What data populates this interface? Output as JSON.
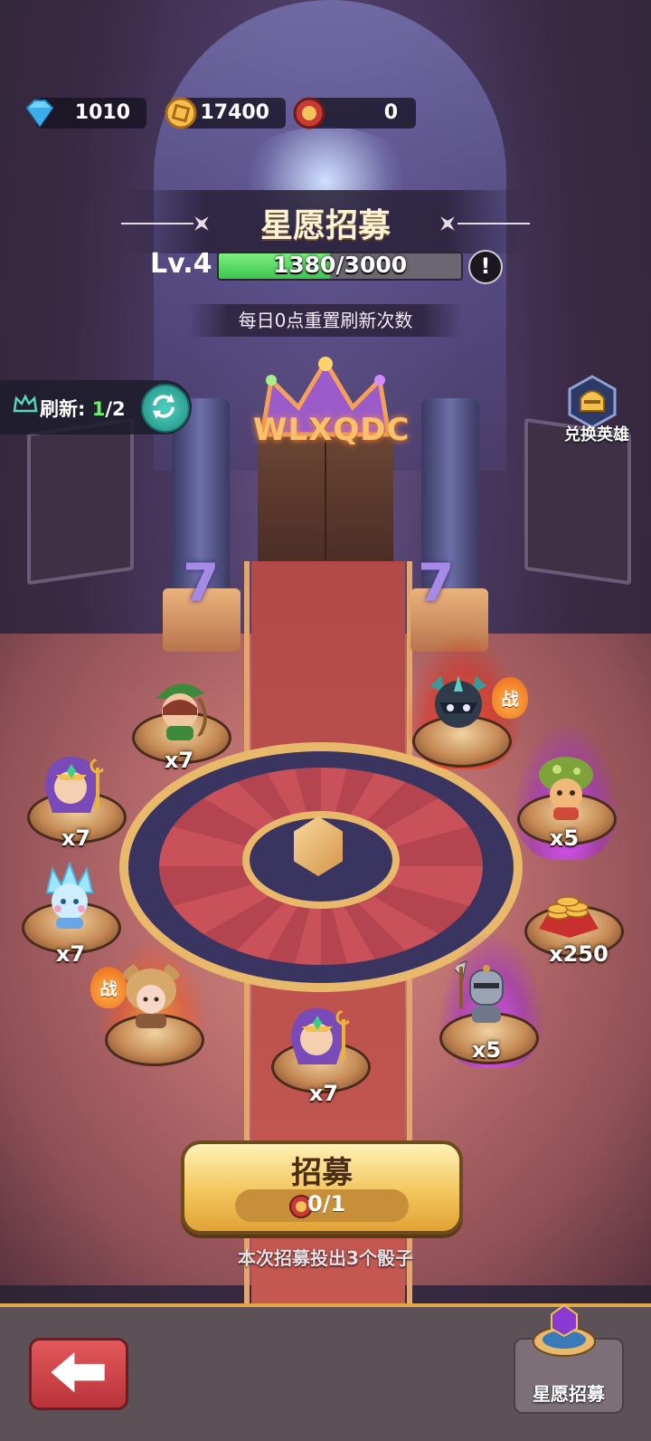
{
  "currencies": {
    "diamonds": "1010",
    "gold": "17400",
    "tokens": "0"
  },
  "banner": {
    "title": "星愿招募",
    "level": "Lv.4",
    "xp_text": "1380/3000",
    "xp_progress": 0.46,
    "info_icon": "!",
    "daily_reset": "每日0点重置刷新次数",
    "sign_text": "WLXQDC"
  },
  "refresh": {
    "label": "刷新:",
    "used": "1",
    "total": "/2"
  },
  "exchange_hero": {
    "label": "兑换英雄"
  },
  "wheel_rewards": [
    {
      "name": "archer-hero",
      "qty": "x7"
    },
    {
      "name": "dark-knight-hero",
      "badge": "战"
    },
    {
      "name": "mage-hero-left",
      "qty": "x7"
    },
    {
      "name": "mushroom-hero",
      "qty": "x5"
    },
    {
      "name": "ice-hero",
      "qty": "x7"
    },
    {
      "name": "gold-coins",
      "qty": "x250"
    },
    {
      "name": "bear-hero",
      "badge": "战"
    },
    {
      "name": "armored-knight-hero",
      "qty": "x5"
    },
    {
      "name": "mage-hero-bottom",
      "qty": "x7"
    }
  ],
  "recruit": {
    "label": "招募",
    "cost": "0/1",
    "hint": "本次招募投出3个骰子"
  },
  "bottom": {
    "tab_label": "星愿招募"
  },
  "colors": {
    "accent_gold": "#e8b86b",
    "xp_green": "#3ec34f",
    "fire_glow": "#ff9a32",
    "purple_glow": "#d84cff"
  }
}
